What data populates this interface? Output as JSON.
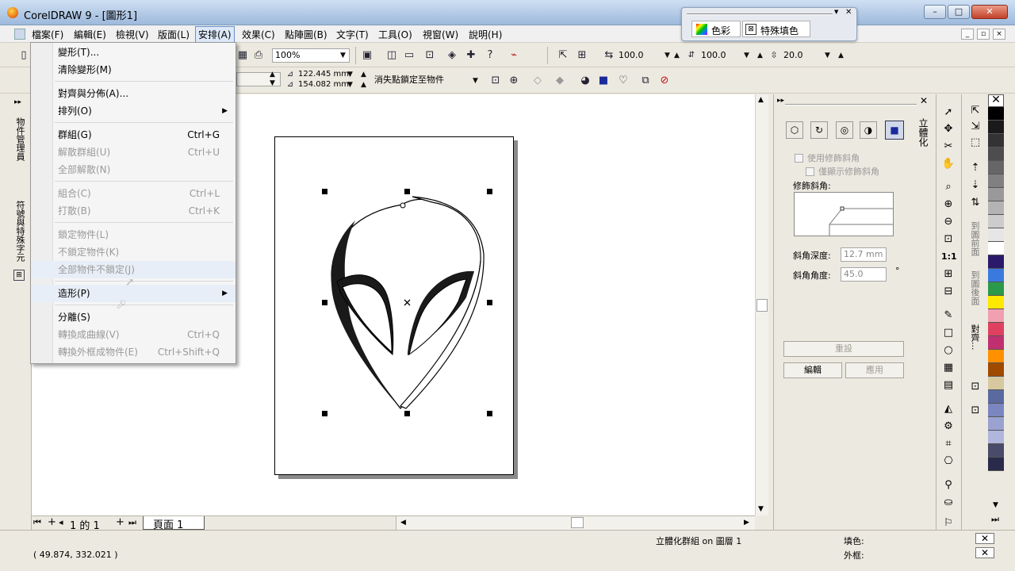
{
  "window": {
    "title": "CorelDRAW 9 - [圖形1]",
    "min": "–",
    "max": "□",
    "close": "✕"
  },
  "menubar": {
    "items": [
      "檔案(F)",
      "編輯(E)",
      "檢視(V)",
      "版面(L)",
      "安排(A)",
      "效果(C)",
      "點陣圖(B)",
      "文字(T)",
      "工具(O)",
      "視窗(W)",
      "說明(H)"
    ]
  },
  "toolbar1": {
    "zoom": "100%",
    "width_val": "100.0",
    "height_val": "100.0",
    "depth_val": "20.0"
  },
  "toolbar2": {
    "x_mm": "122.445 mm",
    "y_mm": "154.082 mm",
    "vp_lock": "消失點鎖定至物件"
  },
  "arrange_menu": {
    "items": [
      {
        "label": "變形(T)...",
        "shortcut": "",
        "disabled": false
      },
      {
        "label": "清除變形(M)",
        "shortcut": "",
        "disabled": false
      },
      {
        "label": "對齊與分佈(A)...",
        "shortcut": "",
        "disabled": false
      },
      {
        "label": "排列(O)",
        "shortcut": "",
        "disabled": false
      },
      {
        "label": "群組(G)",
        "shortcut": "Ctrl+G",
        "disabled": false
      },
      {
        "label": "解散群組(U)",
        "shortcut": "Ctrl+U",
        "disabled": true
      },
      {
        "label": "全部解散(N)",
        "shortcut": "",
        "disabled": true
      },
      {
        "label": "組合(C)",
        "shortcut": "Ctrl+L",
        "disabled": true
      },
      {
        "label": "打散(B)",
        "shortcut": "Ctrl+K",
        "disabled": true
      },
      {
        "label": "鎖定物件(L)",
        "shortcut": "",
        "disabled": true
      },
      {
        "label": "不鎖定物件(K)",
        "shortcut": "",
        "disabled": true
      },
      {
        "label": "全部物件不鎖定(J)",
        "shortcut": "",
        "disabled": true
      },
      {
        "label": "造形(P)",
        "shortcut": "",
        "disabled": false
      },
      {
        "label": "分離(S)",
        "shortcut": "",
        "disabled": false
      },
      {
        "label": "轉換成曲線(V)",
        "shortcut": "Ctrl+Q",
        "disabled": true
      },
      {
        "label": "轉換外框成物件(E)",
        "shortcut": "Ctrl+Shift+Q",
        "disabled": true
      }
    ]
  },
  "color_popup": {
    "tab1": "色彩",
    "tab2": "特殊填色"
  },
  "left_dock": {
    "tab1": "物件管理員",
    "tab2": "符號與特殊字元"
  },
  "page_nav": {
    "counter": "1 的 1",
    "page_tab": "頁面 1"
  },
  "docker": {
    "vtab": "立體化",
    "use_bevel": "使用修飾斜角",
    "show_bevel_only": "僅顯示修飾斜角",
    "bevel_label": "修飾斜角:",
    "depth_label": "斜角深度:",
    "depth_value": "12.7 mm",
    "angle_label": "斜角角度:",
    "angle_value": "45.0",
    "degree": "°",
    "reset": "重設",
    "edit": "編輯",
    "apply": "應用"
  },
  "right_tabs": {
    "t1": "到圖前面",
    "t2": "到圖後面",
    "t3": "對齊..."
  },
  "palette": [
    "#000000",
    "#1a1a1a",
    "#333333",
    "#4d4d4d",
    "#666666",
    "#808080",
    "#999999",
    "#b3b3b3",
    "#cccccc",
    "#e6e6e6",
    "#ffffff",
    "#2a1a6a",
    "#3a7adf",
    "#2a9a4a",
    "#ffe800",
    "#f0a0b0",
    "#e04060",
    "#c03070",
    "#ff9000",
    "#a04a00",
    "#d8c8a0",
    "#5a6aa0",
    "#7a86c0",
    "#9aa2d0",
    "#b0b6dc",
    "#4a4a6a",
    "#2a2a4a"
  ],
  "status": {
    "coords": "( 49.874, 332.021 )",
    "object_info": "立體化群組 on 圖層 1",
    "fill_label": "填色:",
    "outline_label": "外框:"
  }
}
